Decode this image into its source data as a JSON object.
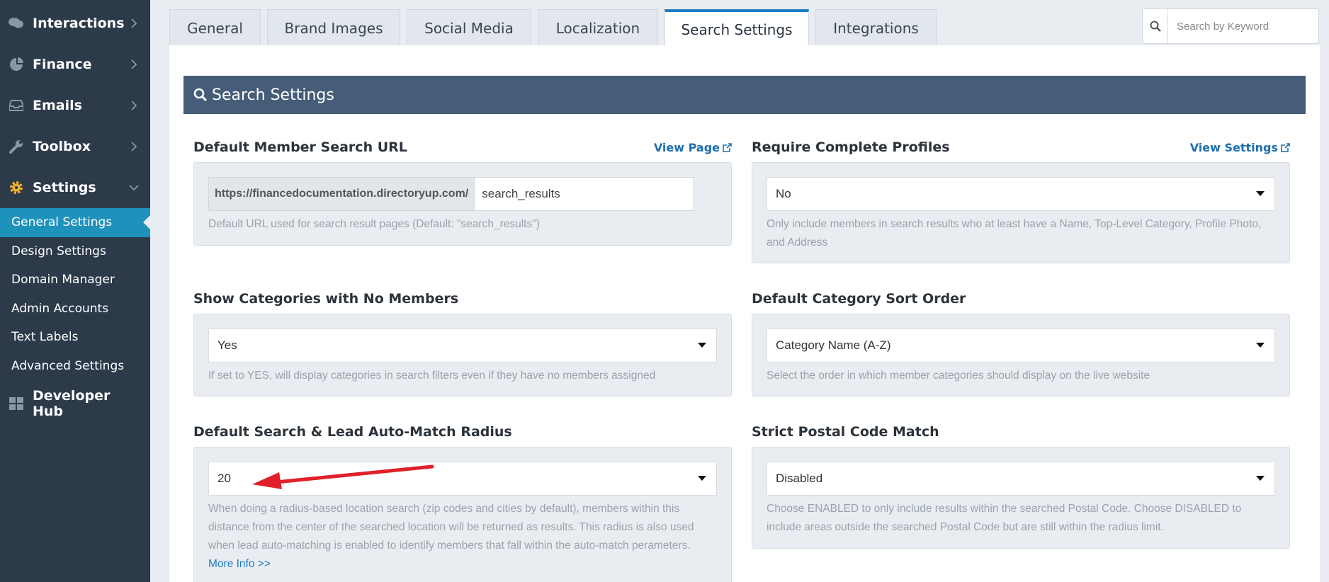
{
  "sidebar": {
    "main_items": [
      {
        "label": "Interactions",
        "icon": "comments-icon"
      },
      {
        "label": "Finance",
        "icon": "pie-chart-icon"
      },
      {
        "label": "Emails",
        "icon": "inbox-icon"
      },
      {
        "label": "Toolbox",
        "icon": "wrench-icon"
      },
      {
        "label": "Settings",
        "icon": "gear-icon"
      }
    ],
    "sub_items": [
      {
        "label": "General Settings"
      },
      {
        "label": "Design Settings"
      },
      {
        "label": "Domain Manager"
      },
      {
        "label": "Admin Accounts"
      },
      {
        "label": "Text Labels"
      },
      {
        "label": "Advanced Settings"
      }
    ],
    "developer_hub": {
      "label": "Developer Hub",
      "icon": "grid-icon"
    }
  },
  "tabs": [
    {
      "label": "General"
    },
    {
      "label": "Brand Images"
    },
    {
      "label": "Social Media"
    },
    {
      "label": "Localization"
    },
    {
      "label": "Search Settings",
      "active": true
    },
    {
      "label": "Integrations"
    }
  ],
  "search": {
    "placeholder": "Search by Keyword"
  },
  "section": {
    "title": "Search Settings"
  },
  "fields": {
    "member_search_url": {
      "title": "Default Member Search URL",
      "link": "View Page",
      "prefix": "https://financedocumentation.directoryup.com/",
      "value": "search_results",
      "help": "Default URL used for search result pages (Default: \"search_results\")"
    },
    "complete_profiles": {
      "title": "Require Complete Profiles",
      "link": "View Settings",
      "value": "No",
      "help": "Only include members in search results who at least have a Name, Top-Level Category, Profile Photo, and Address"
    },
    "show_categories": {
      "title": "Show Categories with No Members",
      "value": "Yes",
      "help": "If set to YES, will display categories in search filters even if they have no members assigned"
    },
    "category_sort": {
      "title": "Default Category Sort Order",
      "value": "Category Name (A-Z)",
      "help": "Select the order in which member categories should display on the live website"
    },
    "radius": {
      "title": "Default Search & Lead Auto-Match Radius",
      "value": "20",
      "help": "When doing a radius-based location search (zip codes and cities by default), members within this distance from the center of the searched location will be returned as results. This radius is also used when lead auto-matching is enabled to identify members that fall within the auto-match perameters.",
      "more_link": "More Info >>"
    },
    "postal_match": {
      "title": "Strict Postal Code Match",
      "value": "Disabled",
      "help": "Choose ENABLED to only include results within the searched Postal Code. Choose DISABLED to include areas outside the searched Postal Code but are still within the radius limit."
    }
  },
  "colors": {
    "sidebar_bg": "#2c3a4a",
    "active_item": "#1f92bb",
    "section_header": "#455d78",
    "link": "#1f6fae",
    "annotation_arrow": "#e0202a"
  }
}
